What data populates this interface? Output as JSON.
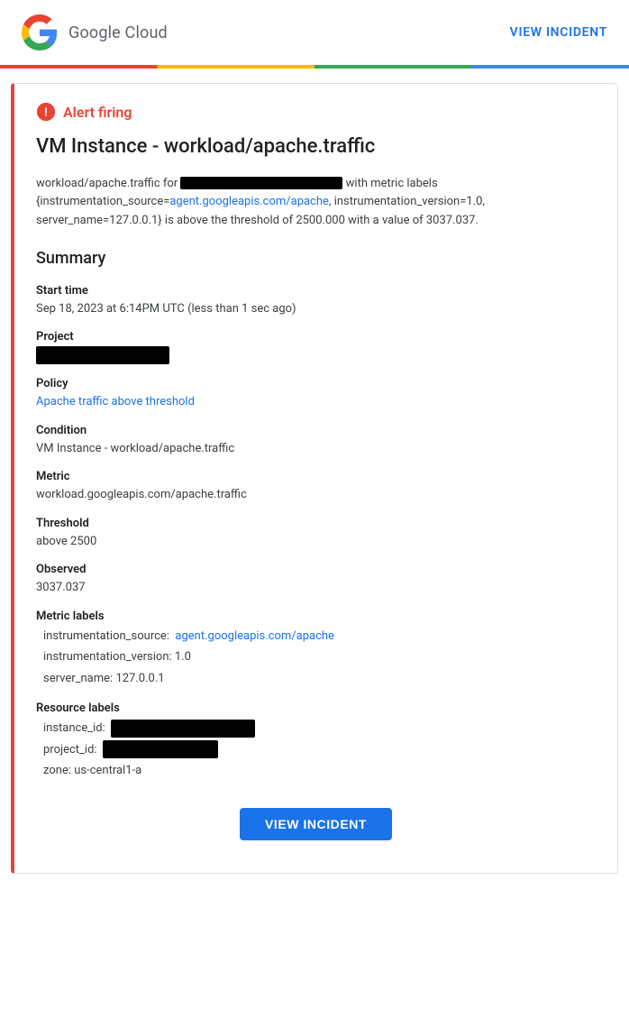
{
  "header": {
    "view_incident_label": "VIEW INCIDENT"
  },
  "alert": {
    "firing_label": "Alert firing",
    "title": "VM Instance - workload/apache.traffic",
    "description_prefix": "workload/apache.traffic for",
    "description_redacted": true,
    "description_suffix": " with metric labels {instrumentation_source=",
    "description_link_text": "agent.googleapis.com/apache",
    "description_link_href": "agent.googleapis.com/apache",
    "description_rest": ", instrumentation_version=1.0, server_name=127.0.0.1} is above the threshold of 2500.000 with a value of 3037.037."
  },
  "summary": {
    "title": "Summary",
    "start_time_label": "Start time",
    "start_time_value": "Sep 18, 2023 at 6:14PM UTC (less than 1 sec ago)",
    "project_label": "Project",
    "policy_label": "Policy",
    "policy_link_text": "Apache traffic above threshold",
    "condition_label": "Condition",
    "condition_value": "VM Instance - workload/apache.traffic",
    "metric_label": "Metric",
    "metric_value": "workload.googleapis.com/apache.traffic",
    "threshold_label": "Threshold",
    "threshold_value": "above 2500",
    "observed_label": "Observed",
    "observed_value": "3037.037",
    "metric_labels_label": "Metric labels",
    "instrumentation_source_label": "instrumentation_source:",
    "instrumentation_source_link": "agent.googleapis.com/apache",
    "instrumentation_version_label": "instrumentation_version:",
    "instrumentation_version_value": "1.0",
    "server_name_label": "server_name:",
    "server_name_value": "127.0.0.1",
    "resource_labels_label": "Resource labels",
    "instance_id_label": "instance_id:",
    "project_id_label": "project_id:",
    "zone_label": "zone:",
    "zone_value": "us-central1-a"
  },
  "footer": {
    "view_incident_btn": "VIEW INCIDENT"
  }
}
